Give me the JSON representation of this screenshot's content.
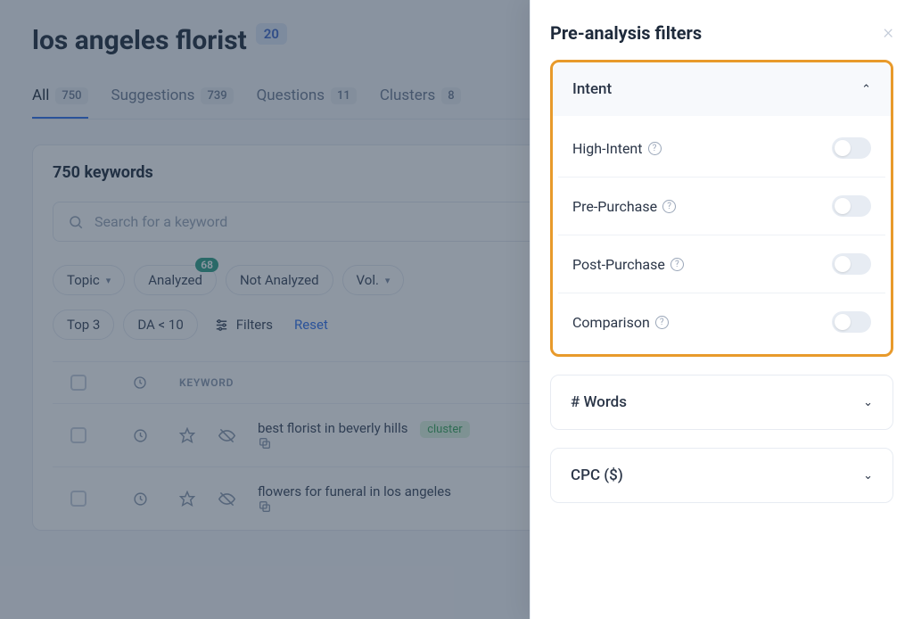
{
  "header": {
    "title": "los angeles florist",
    "badge": "20"
  },
  "tabs": [
    {
      "label": "All",
      "count": "750",
      "active": true
    },
    {
      "label": "Suggestions",
      "count": "739",
      "active": false
    },
    {
      "label": "Questions",
      "count": "11",
      "active": false
    },
    {
      "label": "Clusters",
      "count": "8",
      "active": false
    }
  ],
  "card": {
    "summary": "750 keywords",
    "search_placeholder": "Search for a keyword"
  },
  "chips": {
    "topic": "Topic",
    "analyzed": "Analyzed",
    "analyzed_badge": "68",
    "not_analyzed": "Not Analyzed",
    "vol": "Vol.",
    "top3": "Top 3",
    "da": "DA < 10",
    "filters": "Filters",
    "reset": "Reset"
  },
  "table": {
    "keyword_header": "KEYWORD",
    "rows": [
      {
        "keyword": "best florist in beverly hills",
        "cluster": "cluster"
      },
      {
        "keyword": "flowers for funeral in los angeles",
        "cluster": ""
      }
    ]
  },
  "panel": {
    "title": "Pre-analysis filters",
    "sections": {
      "intent": {
        "title": "Intent",
        "items": [
          {
            "label": "High-Intent"
          },
          {
            "label": "Pre-Purchase"
          },
          {
            "label": "Post-Purchase"
          },
          {
            "label": "Comparison"
          }
        ]
      },
      "words": {
        "title": "# Words"
      },
      "cpc": {
        "title": "CPC ($)"
      }
    }
  }
}
